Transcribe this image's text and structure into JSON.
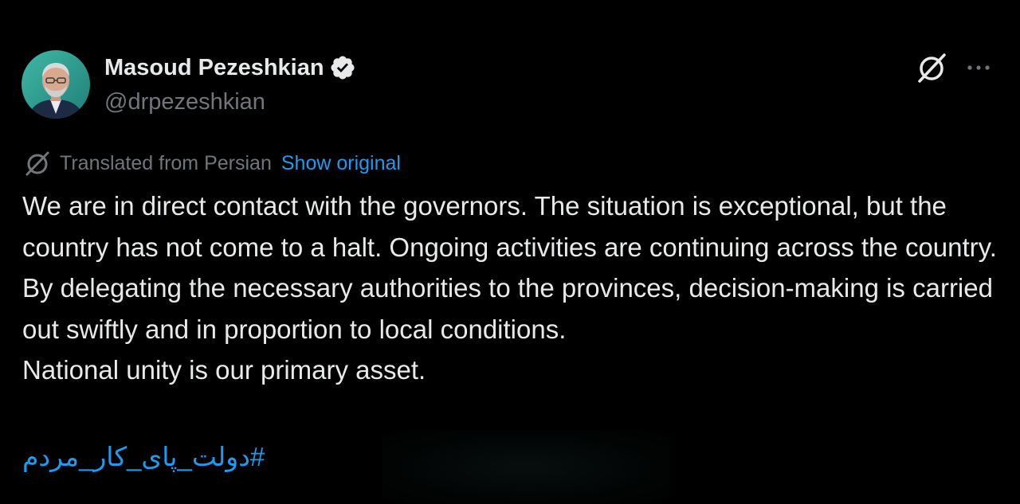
{
  "tweet": {
    "author": {
      "display_name": "Masoud Pezeshkian",
      "handle": "@drpezeshkian",
      "verified": true,
      "avatar_icon": "profile-photo"
    },
    "actions": {
      "grok_icon": "grok-icon",
      "more_icon": "more-icon"
    },
    "translation": {
      "label": "Translated from Persian",
      "show_original": "Show original",
      "icon": "translate-icon"
    },
    "body": "We are in direct contact with the governors. The situation is exceptional, but the country has not come to a halt. Ongoing activities are continuing across the country. By delegating the necessary authorities to the provinces, decision-making is carried out swiftly and in proportion to local conditions.\nNational unity is our primary asset.",
    "hashtag": "#دولت_پای_کار_مردم"
  },
  "colors": {
    "background": "#000000",
    "text": "#e7e9ea",
    "secondary_text": "#71767b",
    "link": "#1d9bf0",
    "verified_badge": "#e7e9ea"
  }
}
